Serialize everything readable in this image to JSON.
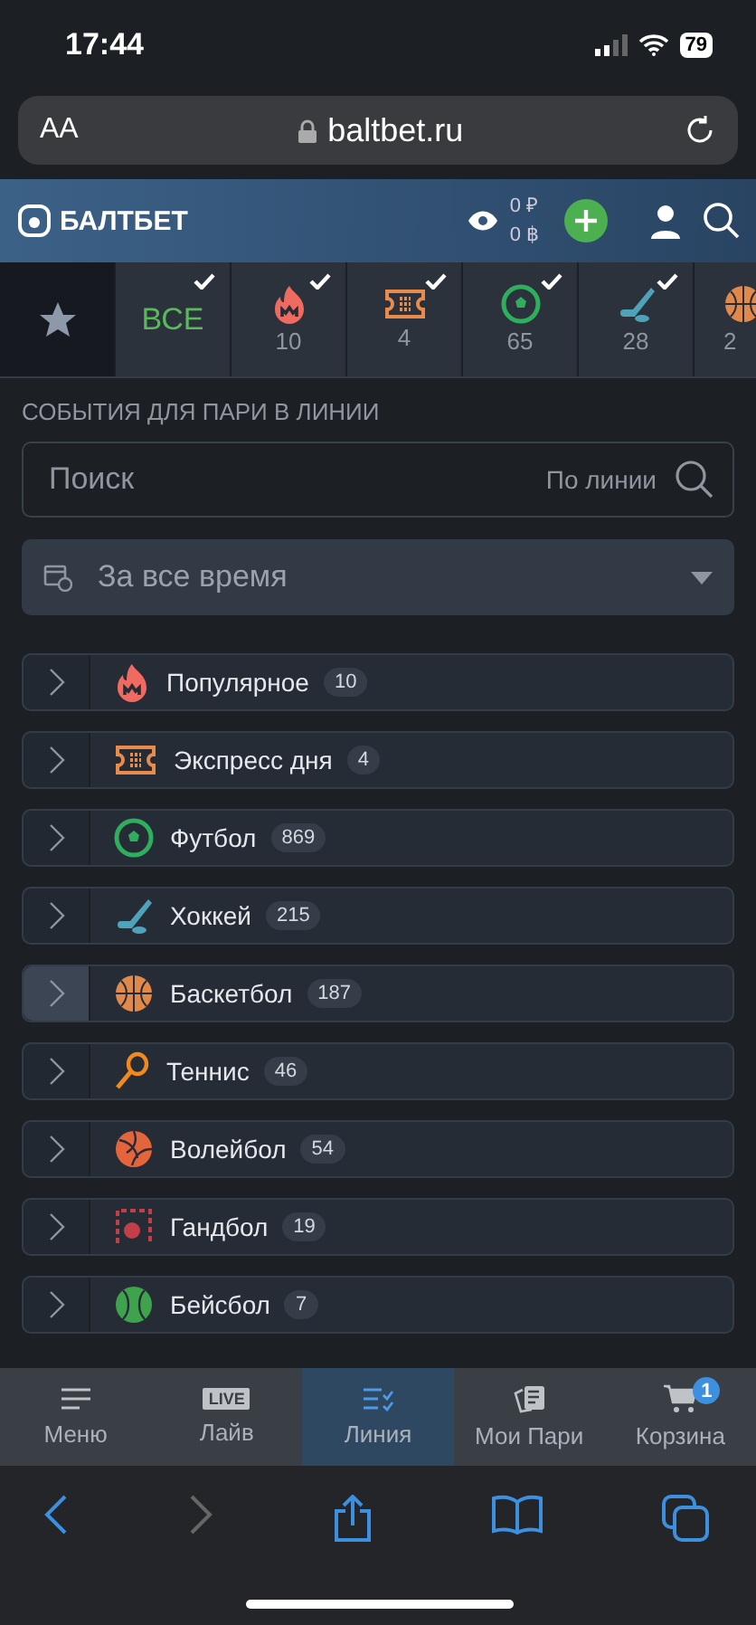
{
  "status_bar": {
    "time": "17:44",
    "battery": "79"
  },
  "browser": {
    "text_size": "AA",
    "url": "baltbet.ru"
  },
  "header": {
    "logo": "БАЛТБЕТ",
    "balance": "0 ₽",
    "bonus": "0 ฿"
  },
  "sport_tabs": [
    {
      "kind": "favorites",
      "selected": true
    },
    {
      "kind": "all",
      "label": "ВСЕ",
      "checked": true,
      "selected": false
    },
    {
      "kind": "fire",
      "count": "10",
      "checked": true,
      "selected": false
    },
    {
      "kind": "ticket",
      "count": "4",
      "checked": true,
      "selected": false
    },
    {
      "kind": "soccer",
      "count": "65",
      "checked": true,
      "selected": false
    },
    {
      "kind": "hockey",
      "count": "28",
      "checked": true,
      "selected": false
    },
    {
      "kind": "basketball",
      "count": "2",
      "selected": false
    }
  ],
  "section_title": "СОБЫТИЯ ДЛЯ ПАРИ В ЛИНИИ",
  "search": {
    "placeholder": "Поиск",
    "scope": "По линии"
  },
  "period": {
    "value": "За все время"
  },
  "categories": [
    {
      "kind": "fire",
      "name": "Популярное",
      "count": "10",
      "selected": false
    },
    {
      "kind": "ticket",
      "name": "Экспресс дня",
      "count": "4",
      "selected": false
    },
    {
      "kind": "soccer",
      "name": "Футбол",
      "count": "869",
      "selected": false
    },
    {
      "kind": "hockey",
      "name": "Хоккей",
      "count": "215",
      "selected": false
    },
    {
      "kind": "basketball",
      "name": "Баскетбол",
      "count": "187",
      "selected": true
    },
    {
      "kind": "tennis",
      "name": "Теннис",
      "count": "46",
      "selected": false
    },
    {
      "kind": "volleyball",
      "name": "Волейбол",
      "count": "54",
      "selected": false
    },
    {
      "kind": "handball",
      "name": "Гандбол",
      "count": "19",
      "selected": false
    },
    {
      "kind": "baseball",
      "name": "Бейсбол",
      "count": "7",
      "selected": false
    }
  ],
  "bottom_nav": [
    {
      "kind": "menu",
      "label": "Меню",
      "selected": false
    },
    {
      "kind": "live",
      "label": "Лайв",
      "icon_text": "LIVE",
      "selected": false
    },
    {
      "kind": "line",
      "label": "Линия",
      "selected": true
    },
    {
      "kind": "bets",
      "label": "Мои Пари",
      "selected": false
    },
    {
      "kind": "cart",
      "label": "Корзина",
      "badge": "1",
      "selected": false
    }
  ]
}
